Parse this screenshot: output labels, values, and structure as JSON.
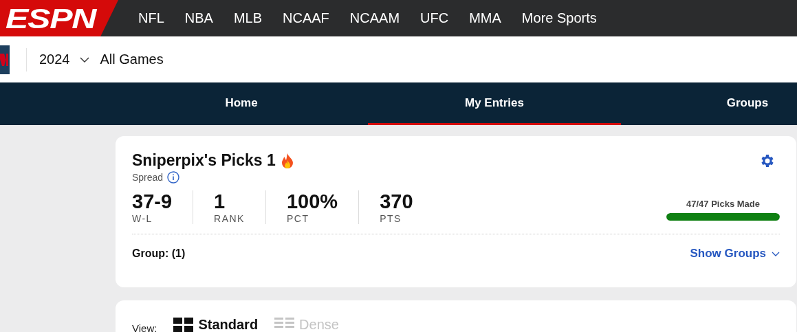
{
  "brand": {
    "logo": "ESPN"
  },
  "sports_nav": [
    "NFL",
    "NBA",
    "MLB",
    "NCAAF",
    "NCAAM",
    "UFC",
    "MMA",
    "More Sports"
  ],
  "sub_header": {
    "season": "2024",
    "filter": "All Games"
  },
  "tabs": [
    {
      "label": "Home",
      "selected": false
    },
    {
      "label": "My Entries",
      "selected": true
    },
    {
      "label": "Groups",
      "selected": false
    }
  ],
  "entry": {
    "title": "Sniperpix's Picks 1",
    "game_type": "Spread",
    "stats": [
      {
        "value": "37-9",
        "label": "W-L"
      },
      {
        "value": "1",
        "label": "RANK"
      },
      {
        "value": "100%",
        "label": "PCT"
      },
      {
        "value": "370",
        "label": "PTS"
      }
    ],
    "picks": {
      "text": "47/47 Picks Made",
      "level": 1
    },
    "group": "Group: (1)",
    "show_groups": "Show Groups"
  },
  "view": {
    "label": "View:",
    "options": [
      {
        "label": "Standard",
        "selected": true
      },
      {
        "label": "Dense",
        "selected": false
      }
    ]
  }
}
